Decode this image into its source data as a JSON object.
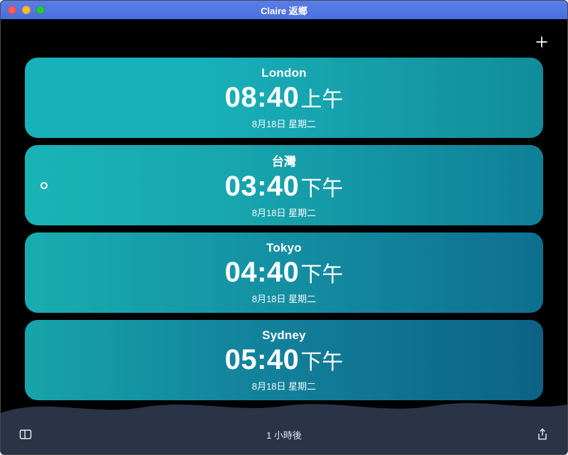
{
  "window": {
    "title": "Claire 返鄉"
  },
  "toolbar": {
    "add_icon": "plus-icon"
  },
  "cities": [
    {
      "name": "London",
      "time": "08:40",
      "ampm": "上午",
      "date": "8月18日 星期二",
      "is_current": false
    },
    {
      "name": "台灣",
      "time": "03:40",
      "ampm": "下午",
      "date": "8月18日 星期二",
      "is_current": true
    },
    {
      "name": "Tokyo",
      "time": "04:40",
      "ampm": "下午",
      "date": "8月18日 星期二",
      "is_current": false
    },
    {
      "name": "Sydney",
      "time": "05:40",
      "ampm": "下午",
      "date": "8月18日 星期二",
      "is_current": false
    }
  ],
  "footer": {
    "offset_label": "1 小時後",
    "left_icon": "sidebar-toggle-icon",
    "right_icon": "share-icon"
  }
}
